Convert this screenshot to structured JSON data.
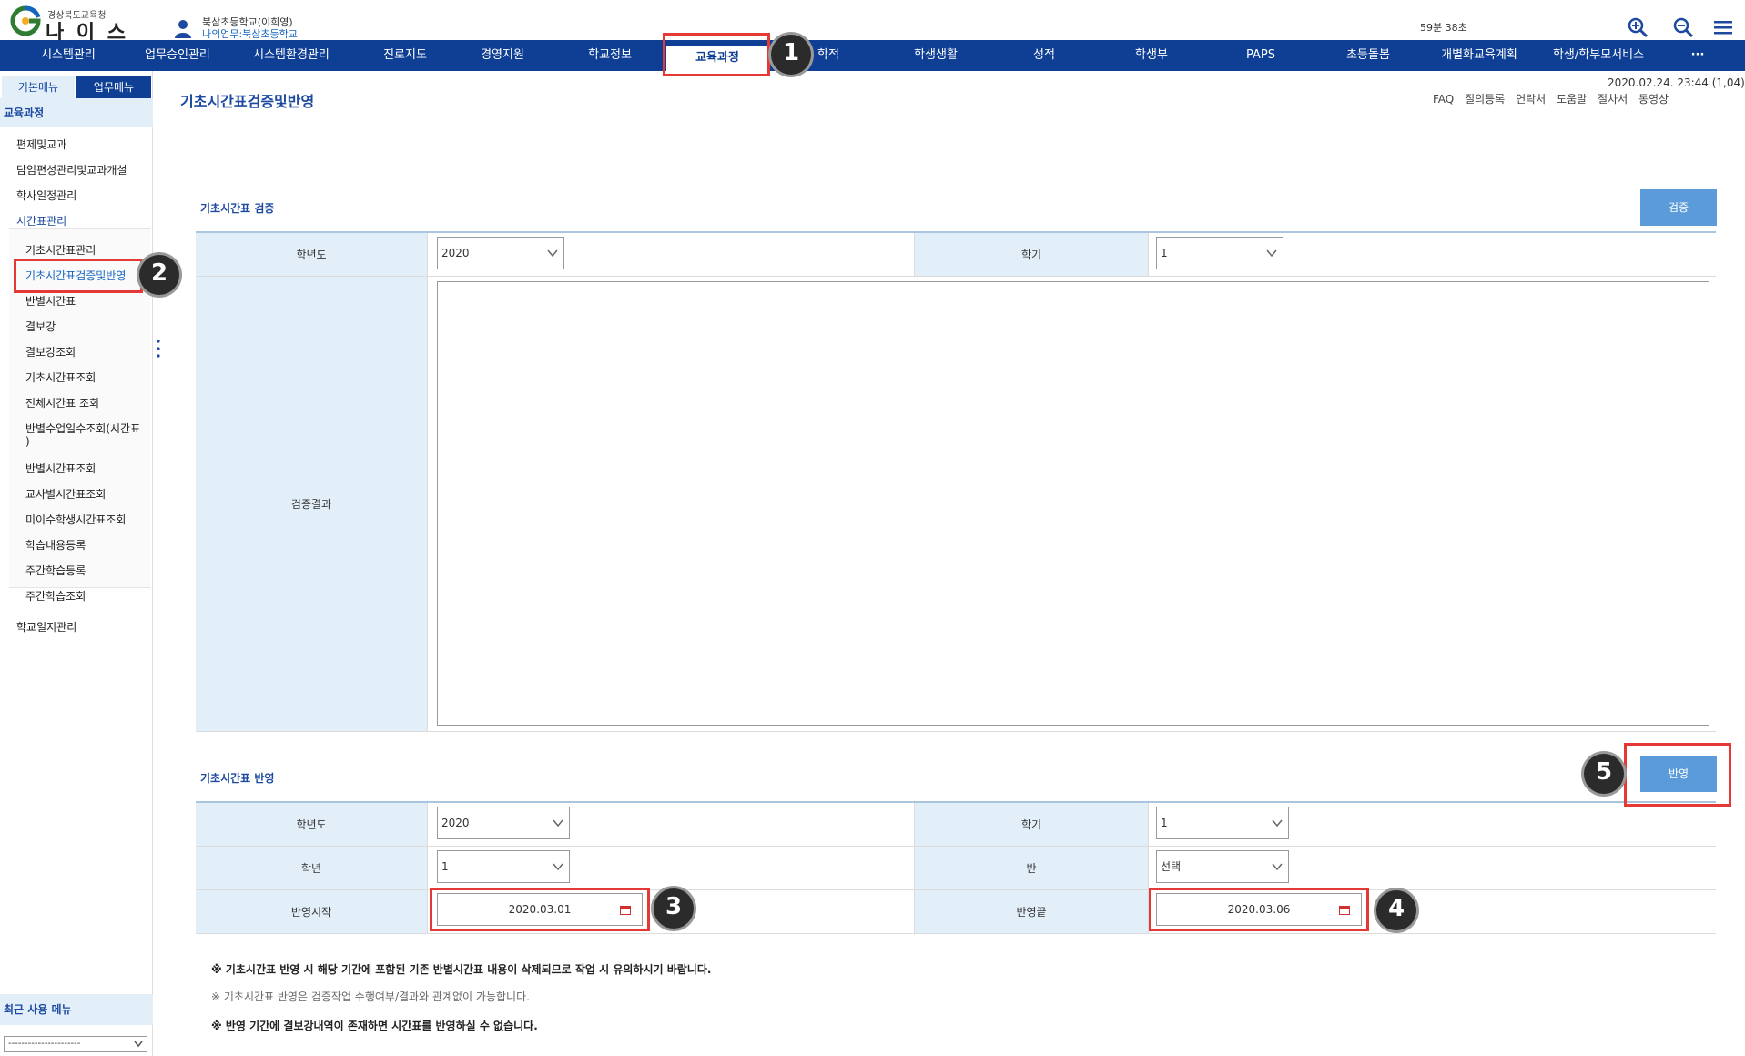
{
  "header": {
    "org": "경상북도교육청",
    "app_name": "나 이 스",
    "school": "북삼초등학교(이희영)",
    "work": "나의업무:북삼초등학교",
    "timer": "59분 38초",
    "icons": [
      "zoom-in-icon",
      "zoom-out-icon",
      "menu-icon"
    ]
  },
  "nav": {
    "items": [
      "시스템관리",
      "업무승인관리",
      "시스템환경관리",
      "진로지도",
      "경영지원",
      "학교정보",
      "교육과정",
      "학적",
      "학생생활",
      "성적",
      "학생부",
      "PAPS",
      "초등돌봄",
      "개별화교육계획",
      "학생/학부모서비스",
      "···"
    ],
    "active": "교육과정"
  },
  "sidebar": {
    "tab_basic": "기본메뉴",
    "tab_work": "업무메뉴",
    "section": "교육과정",
    "items": [
      "편제및교과",
      "담임편성관리및교과개설",
      "학사일정관리"
    ],
    "group": "시간표관리",
    "subitems": [
      "기초시간표관리",
      "기초시간표검증및반영",
      "반별시간표",
      "결보강",
      "결보강조회",
      "기초시간표조회",
      "전체시간표 조회",
      "반별수업일수조회(시간표",
      ")",
      "반별시간표조회",
      "교사별시간표조회",
      "미이수학생시간표조회",
      "학습내용등록",
      "주간학습등록",
      "주간학습조회"
    ],
    "active_subitem": "기초시간표검증및반영",
    "bottom_item": "학교일지관리",
    "recent_title": "최근 사용 메뉴",
    "recent_select": "----------------------"
  },
  "page": {
    "title": "기초시간표검증및반영",
    "datetime": "2020.02.24. 23:44 (1,04)",
    "links": [
      "FAQ",
      "질의등록",
      "연락처",
      "도움말",
      "절차서",
      "동영상"
    ]
  },
  "verify": {
    "title": "기초시간표 검증",
    "button": "검증",
    "year_label": "학년도",
    "year_value": "2020",
    "term_label": "학기",
    "term_value": "1",
    "result_label": "검증결과"
  },
  "apply": {
    "title": "기초시간표 반영",
    "button": "반영",
    "year_label": "학년도",
    "year_value": "2020",
    "term_label": "학기",
    "term_value": "1",
    "grade_label": "학년",
    "grade_value": "1",
    "class_label": "반",
    "class_value": "선택",
    "start_label": "반영시작",
    "start_value": "2020.03.01",
    "end_label": "반영끝",
    "end_value": "2020.03.06"
  },
  "notices": [
    "※ 기초시간표 반영 시 해당 기간에 포함된 기존 반별시간표 내용이 삭제되므로 작업 시 유의하시기 바랍니다.",
    "※ 기초시간표 반영은 검증작업 수행여부/결과와 관계없이 가능합니다.",
    "※ 반영 기간에 결보강내역이 존재하면 시간표를 반영하실 수 없습니다."
  ],
  "annotations": [
    "1",
    "2",
    "3",
    "4",
    "5"
  ],
  "colors": {
    "nav_bg": "#0f3f94",
    "label_bg": "#e2eef8",
    "button": "#5b9bd9",
    "highlight": "#e53935"
  }
}
